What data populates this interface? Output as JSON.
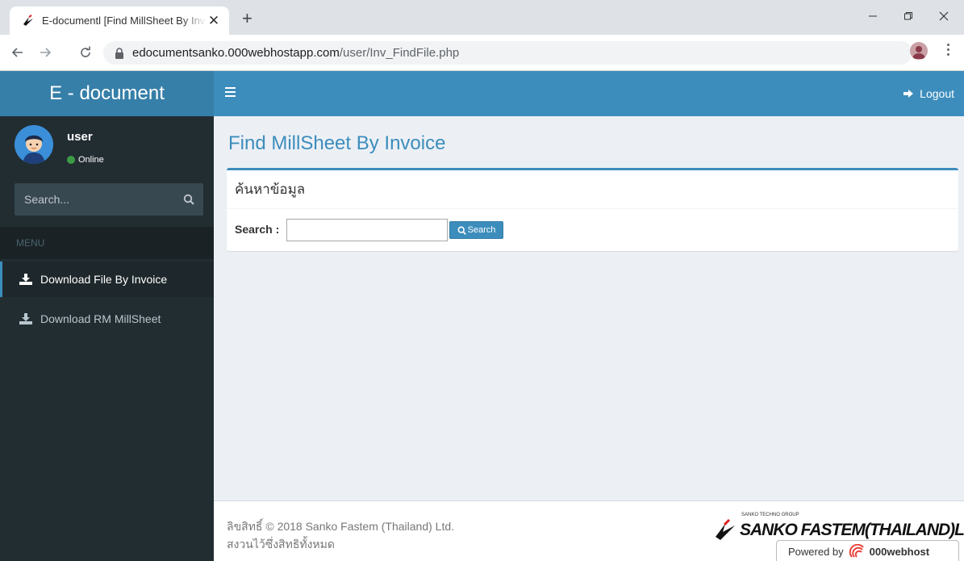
{
  "browser": {
    "tab_title": "E-documentl [Find MillSheet By Invoice]",
    "tab_close": "✕",
    "new_tab": "+",
    "url_host": "edocumentsanko.000webhostapp.com",
    "url_path": "/user/Inv_FindFile.php"
  },
  "app": {
    "brand": "E - document",
    "logout_label": "Logout"
  },
  "sidebar": {
    "user_name": "user",
    "user_status": "Online",
    "search_placeholder": "Search...",
    "menu_header": "MENU",
    "items": [
      {
        "label": "Download File By Invoice",
        "active": true
      },
      {
        "label": "Download RM MillSheet",
        "active": false
      }
    ]
  },
  "main": {
    "page_title": "Find MillSheet By Invoice",
    "box_title": "ค้นหาข้อมูล",
    "search_label": "Search :",
    "search_value": "",
    "search_button": "Search"
  },
  "footer": {
    "copyright_line1": "ลิขสิทธิ์ © 2018 Sanko Fastem (Thailand) Ltd.",
    "copyright_line2": "สงวนไว้ซึ่งสิทธิทั้งหมด",
    "company_logo_text": "SANKO FASTEM(THAILAND)LTD.",
    "company_logo_small": "SANKO TECHNO GROUP",
    "powered_by": "Powered by",
    "webhost_name": "000webhost"
  },
  "colors": {
    "brand_bg": "#367fa9",
    "topnav_bg": "#3c8dbc",
    "sidebar_bg": "#222d32",
    "content_bg": "#ecf0f5",
    "online": "#3c9b45"
  }
}
